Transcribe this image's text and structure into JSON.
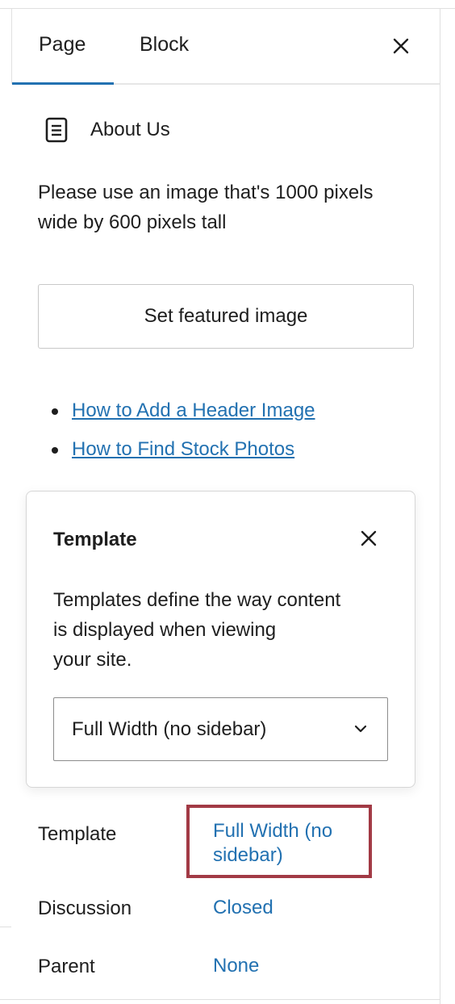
{
  "tabs": [
    {
      "label": "Page",
      "active": true
    },
    {
      "label": "Block",
      "active": false
    }
  ],
  "page_summary": {
    "title": "About Us",
    "featured_image_help": "Please use an image that's 1000 pixels wide by 600 pixels tall",
    "set_featured_image_label": "Set featured image"
  },
  "help_links": [
    {
      "label": "How to Add a Header Image"
    },
    {
      "label": "How to Find Stock Photos"
    }
  ],
  "template_popover": {
    "title": "Template",
    "description_lines": [
      "Templates define the way content",
      "is displayed when viewing",
      "your site."
    ],
    "selected_template": "Full Width (no sidebar)"
  },
  "settings": {
    "template": {
      "label": "Template",
      "value_lines": [
        "Full Width (no",
        "sidebar)"
      ]
    },
    "discussion": {
      "label": "Discussion",
      "value": "Closed"
    },
    "parent": {
      "label": "Parent",
      "value": "None"
    }
  },
  "icons": {
    "close": "close-icon",
    "page": "page-document-icon",
    "dropdown": "chevron-down-icon"
  },
  "colors": {
    "accent": "#2271b1",
    "highlight_border": "#a23a45",
    "text": "#1e1e1e"
  }
}
